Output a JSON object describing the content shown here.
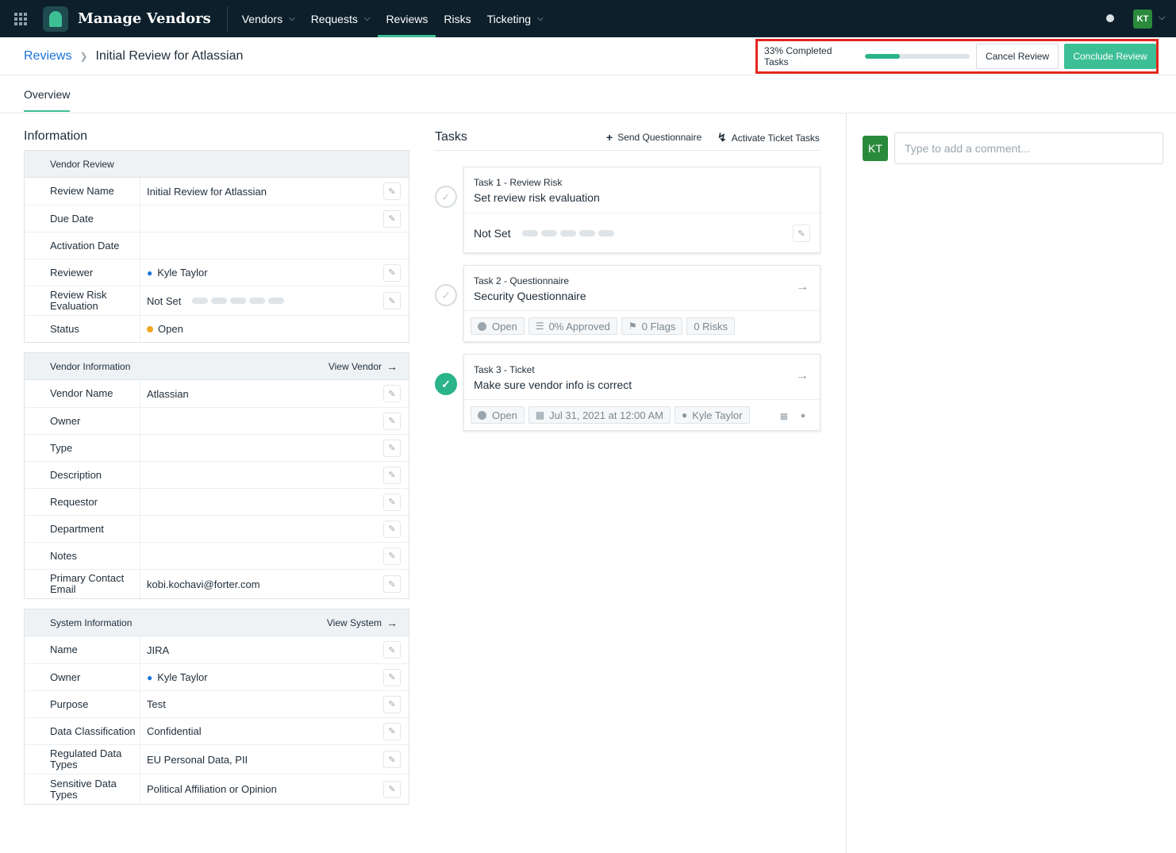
{
  "nav": {
    "app_title": "Manage Vendors",
    "items": [
      {
        "label": "Vendors",
        "has_menu": true
      },
      {
        "label": "Requests",
        "has_menu": true
      },
      {
        "label": "Reviews",
        "has_menu": false,
        "active": true
      },
      {
        "label": "Risks",
        "has_menu": false
      },
      {
        "label": "Ticketing",
        "has_menu": true
      }
    ],
    "user_initials": "KT"
  },
  "header": {
    "breadcrumb_root": "Reviews",
    "breadcrumb_current": "Initial Review for Atlassian",
    "progress_text": "33% Completed Tasks",
    "progress_fraction": 0.33,
    "cancel_label": "Cancel Review",
    "conclude_label": "Conclude Review"
  },
  "tabs": {
    "overview": "Overview"
  },
  "information": {
    "title": "Information",
    "vendor_review": {
      "heading": "Vendor Review",
      "rows": [
        {
          "label": "Review Name",
          "value": "Initial Review for Atlassian"
        },
        {
          "label": "Due Date",
          "value": ""
        },
        {
          "label": "Activation Date",
          "value": ""
        },
        {
          "label": "Reviewer",
          "value": "Kyle Taylor"
        },
        {
          "label": "Review Risk Evaluation",
          "value": "Not Set"
        },
        {
          "label": "Status",
          "value": "Open"
        }
      ]
    },
    "vendor_information": {
      "heading": "Vendor Information",
      "link": "View Vendor",
      "rows": [
        {
          "label": "Vendor Name",
          "value": "Atlassian"
        },
        {
          "label": "Owner",
          "value": ""
        },
        {
          "label": "Type",
          "value": ""
        },
        {
          "label": "Description",
          "value": ""
        },
        {
          "label": "Requestor",
          "value": ""
        },
        {
          "label": "Department",
          "value": ""
        },
        {
          "label": "Notes",
          "value": ""
        },
        {
          "label": "Primary Contact Email",
          "value": "kobi.kochavi@forter.com"
        }
      ]
    },
    "system_information": {
      "heading": "System Information",
      "link": "View System",
      "rows": [
        {
          "label": "Name",
          "value": "JIRA"
        },
        {
          "label": "Owner",
          "value": "Kyle Taylor"
        },
        {
          "label": "Purpose",
          "value": "Test"
        },
        {
          "label": "Data Classification",
          "value": "Confidential"
        },
        {
          "label": "Regulated Data Types",
          "value": "EU Personal Data, PII"
        },
        {
          "label": "Sensitive Data Types",
          "value": "Political Affiliation or Opinion"
        }
      ]
    }
  },
  "tasks": {
    "title": "Tasks",
    "send_questionnaire": "Send Questionnaire",
    "activate_ticket_tasks": "Activate Ticket Tasks",
    "items": [
      {
        "kind": "Task 1 - Review Risk",
        "name": "Set review risk evaluation",
        "status": "Not Set",
        "done": false
      },
      {
        "kind": "Task 2 - Questionnaire",
        "name": "Security Questionnaire",
        "chips": [
          "Open",
          "0% Approved",
          "0 Flags",
          "0 Risks"
        ],
        "done": false
      },
      {
        "kind": "Task 3 - Ticket",
        "name": "Make sure vendor info is correct",
        "chips": [
          "Open",
          "Jul 31, 2021 at 12:00 AM",
          "Kyle Taylor"
        ],
        "done": true
      }
    ]
  },
  "comments": {
    "user_initials": "KT",
    "placeholder": "Type to add a comment..."
  },
  "colors": {
    "nav_bg": "#0c1f2b",
    "accent": "#3dbf95",
    "link": "#1a73d9",
    "highlight_border": "#e3271d",
    "status_open": "#f5a623"
  }
}
